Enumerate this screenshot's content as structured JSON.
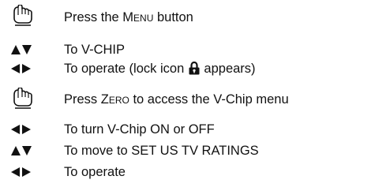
{
  "steps": [
    {
      "icon": "press-hand-icon",
      "segments": [
        "Press the ",
        "Menu",
        " button"
      ]
    },
    {
      "icon": "up-down-arrows-icon",
      "text": "To V-CHIP"
    },
    {
      "icon": "left-right-arrows-icon",
      "before": "To operate (lock icon ",
      "after": " appears)",
      "inline_icon": "lock-icon"
    },
    {
      "icon": "press-hand-icon",
      "segments": [
        "Press ",
        "Zero",
        " to access the V-Chip menu"
      ]
    },
    {
      "icon": "left-right-arrows-icon",
      "text": "To turn V-Chip ON or OFF"
    },
    {
      "icon": "up-down-arrows-icon",
      "text": "To move to SET US TV RATINGS"
    },
    {
      "icon": "left-right-arrows-icon",
      "text": "To operate"
    }
  ]
}
